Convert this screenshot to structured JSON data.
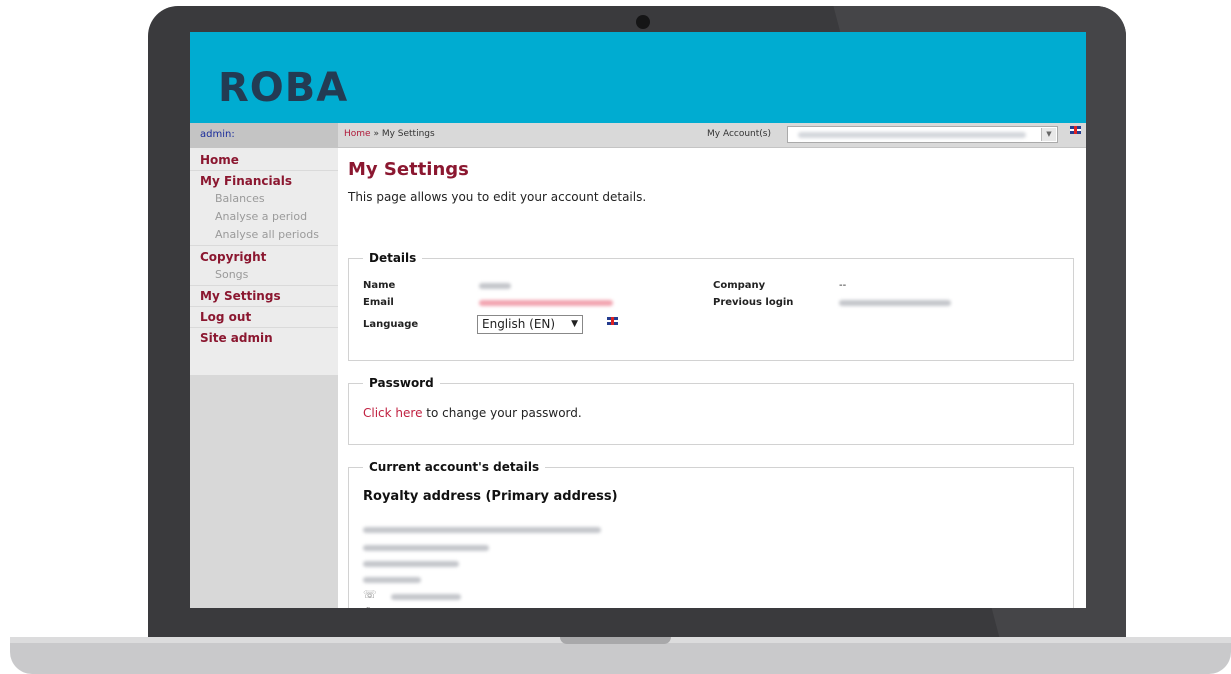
{
  "brand": {
    "logo_text": "ROBA"
  },
  "topbar": {
    "user_label": "admin:",
    "breadcrumb_home": "Home",
    "breadcrumb_sep": " » ",
    "breadcrumb_current": "My Settings",
    "account_label": "My Account(s)"
  },
  "sidebar": {
    "items": [
      {
        "label": "Home"
      },
      {
        "label": "My Financials"
      },
      {
        "label": "Balances"
      },
      {
        "label": "Analyse a period"
      },
      {
        "label": "Analyse all periods"
      },
      {
        "label": "Copyright"
      },
      {
        "label": "Songs"
      },
      {
        "label": "My Settings"
      },
      {
        "label": "Log out"
      },
      {
        "label": "Site admin"
      }
    ]
  },
  "main": {
    "title": "My Settings",
    "intro": "This page allows you to edit your account details.",
    "details": {
      "legend": "Details",
      "name_label": "Name",
      "email_label": "Email",
      "language_label": "Language",
      "language_value": "English (EN)",
      "company_label": "Company",
      "company_value": "--",
      "previous_login_label": "Previous login"
    },
    "password": {
      "legend": "Password",
      "link_text": "Click here",
      "text": " to change your password."
    },
    "account": {
      "legend": "Current account's details",
      "address_title": "Royalty address (Primary address)"
    }
  },
  "icons": {
    "account_dropdown": "chevron-down-icon",
    "flag": "uk-flag-icon",
    "phone": "phone-icon",
    "fax": "fax-icon",
    "email": "mail-icon"
  },
  "colors": {
    "header": "#00acd1",
    "logo": "#233b53",
    "accent": "#8b1730",
    "link": "#c02040",
    "sidebar": "#d8d8d8"
  }
}
